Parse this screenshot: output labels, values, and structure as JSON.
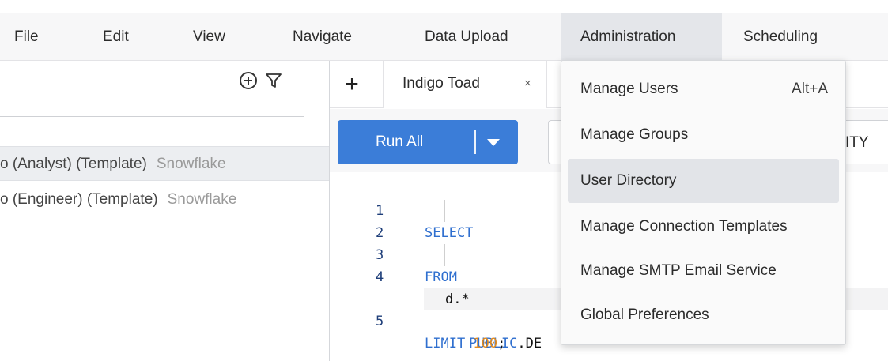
{
  "menubar": {
    "items": [
      {
        "label": "File"
      },
      {
        "label": "Edit"
      },
      {
        "label": "View"
      },
      {
        "label": "Navigate"
      },
      {
        "label": "Data Upload"
      },
      {
        "label": "Administration"
      },
      {
        "label": "Scheduling"
      }
    ],
    "active": "Administration"
  },
  "left_panel": {
    "connections": [
      {
        "name": "o (Analyst) (Template)",
        "type": "Snowflake"
      },
      {
        "name": "o (Engineer) (Template)",
        "type": "Snowflake"
      }
    ]
  },
  "tabs": {
    "add_label": "+",
    "items": [
      {
        "label": "Indigo Toad",
        "close": "×"
      }
    ]
  },
  "toolbar": {
    "run_label": "Run All",
    "edge_text": "ITY"
  },
  "code": {
    "lines": [
      {
        "n": "1",
        "text": "SELECT"
      },
      {
        "n": "2",
        "text": "d.*"
      },
      {
        "n": "3",
        "text": "FROM"
      },
      {
        "n": "4",
        "text_kw": "PUBLIC",
        "text_rest": ".DE"
      },
      {
        "n": "5",
        "text_kw": "LIMIT ",
        "text_num": "100",
        "text_rest": ";"
      }
    ]
  },
  "admin_menu": {
    "items": [
      {
        "label": "Manage Users",
        "shortcut": "Alt+A"
      },
      {
        "label": "Manage Groups"
      },
      {
        "label": "User Directory"
      },
      {
        "label": "Manage Connection Templates"
      },
      {
        "label": "Manage SMTP Email Service"
      },
      {
        "label": "Global Preferences"
      }
    ],
    "hovered": "User Directory"
  },
  "colors": {
    "accent": "#3b7dd8",
    "keyword": "#2f6fcf",
    "number": "#e08a1f"
  }
}
